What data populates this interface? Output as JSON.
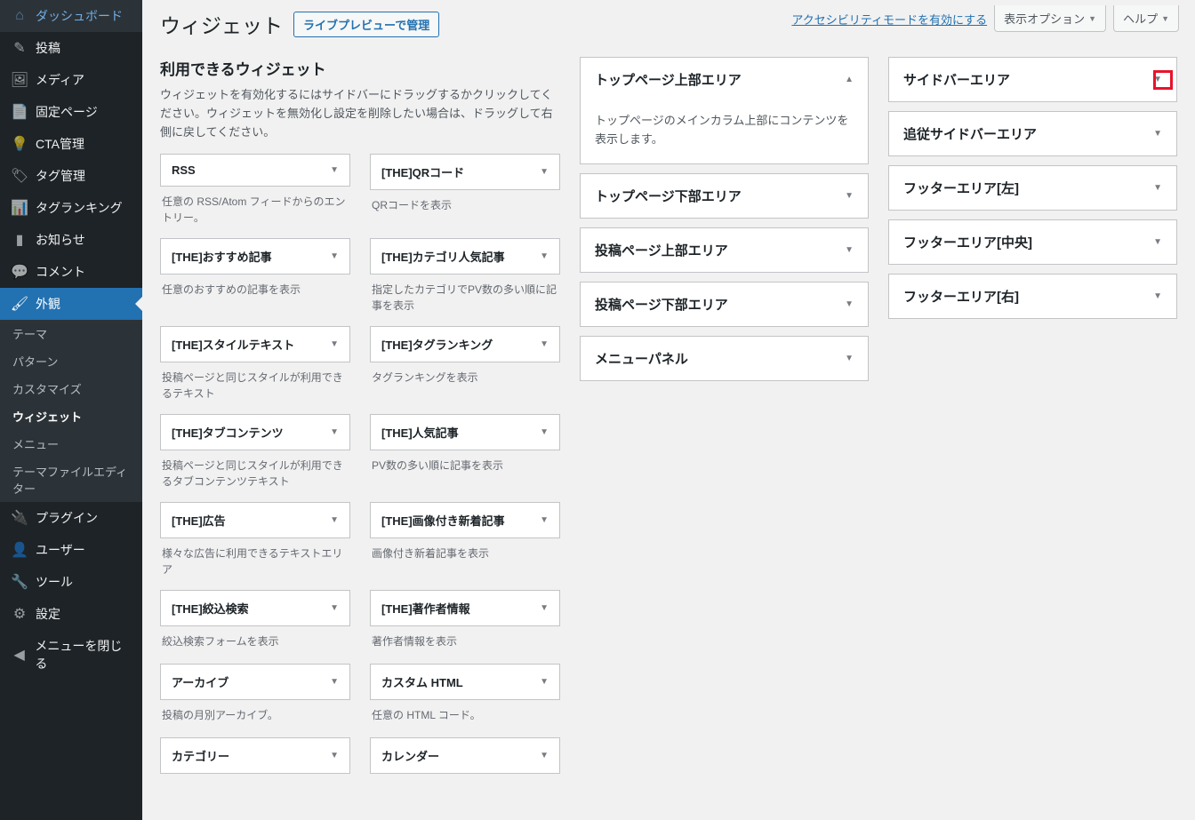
{
  "sidebar": {
    "items": [
      {
        "icon": "dashboard",
        "label": "ダッシュボード"
      },
      {
        "icon": "pin",
        "label": "投稿"
      },
      {
        "icon": "media",
        "label": "メディア"
      },
      {
        "icon": "page",
        "label": "固定ページ"
      },
      {
        "icon": "bulb",
        "label": "CTA管理"
      },
      {
        "icon": "tag",
        "label": "タグ管理"
      },
      {
        "icon": "rank",
        "label": "タグランキング"
      },
      {
        "icon": "news",
        "label": "お知らせ"
      },
      {
        "icon": "comment",
        "label": "コメント"
      },
      {
        "icon": "appearance",
        "label": "外観",
        "current": true
      },
      {
        "icon": "plugin",
        "label": "プラグイン"
      },
      {
        "icon": "user",
        "label": "ユーザー"
      },
      {
        "icon": "tool",
        "label": "ツール"
      },
      {
        "icon": "settings",
        "label": "設定"
      },
      {
        "icon": "collapse",
        "label": "メニューを閉じる"
      }
    ],
    "sub": [
      {
        "label": "テーマ"
      },
      {
        "label": "パターン"
      },
      {
        "label": "カスタマイズ"
      },
      {
        "label": "ウィジェット",
        "current": true
      },
      {
        "label": "メニュー"
      },
      {
        "label": "テーマファイルエディター"
      }
    ]
  },
  "topbar": {
    "accessibility": "アクセシビリティモードを有効にする",
    "screen_options": "表示オプション",
    "help": "ヘルプ"
  },
  "page": {
    "title": "ウィジェット",
    "preview_btn": "ライブプレビューで管理"
  },
  "available": {
    "heading": "利用できるウィジェット",
    "desc": "ウィジェットを有効化するにはサイドバーにドラッグするかクリックしてください。ウィジェットを無効化し設定を削除したい場合は、ドラッグして右側に戻してください。"
  },
  "widgets": [
    {
      "name": "RSS",
      "desc": "任意の RSS/Atom フィードからのエントリー。"
    },
    {
      "name": "[THE]QRコード",
      "desc": "QRコードを表示"
    },
    {
      "name": "[THE]おすすめ記事",
      "desc": "任意のおすすめの記事を表示"
    },
    {
      "name": "[THE]カテゴリ人気記事",
      "desc": "指定したカテゴリでPV数の多い順に記事を表示"
    },
    {
      "name": "[THE]スタイルテキスト",
      "desc": "投稿ページと同じスタイルが利用できるテキスト"
    },
    {
      "name": "[THE]タグランキング",
      "desc": "タグランキングを表示"
    },
    {
      "name": "[THE]タブコンテンツ",
      "desc": "投稿ページと同じスタイルが利用できるタブコンテンツテキスト"
    },
    {
      "name": "[THE]人気記事",
      "desc": "PV数の多い順に記事を表示"
    },
    {
      "name": "[THE]広告",
      "desc": "様々な広告に利用できるテキストエリア"
    },
    {
      "name": "[THE]画像付き新着記事",
      "desc": "画像付き新着記事を表示"
    },
    {
      "name": "[THE]絞込検索",
      "desc": "絞込検索フォームを表示"
    },
    {
      "name": "[THE]著作者情報",
      "desc": "著作者情報を表示"
    },
    {
      "name": "アーカイブ",
      "desc": "投稿の月別アーカイブ。"
    },
    {
      "name": "カスタム HTML",
      "desc": "任意の HTML コード。"
    },
    {
      "name": "カテゴリー",
      "desc": ""
    },
    {
      "name": "カレンダー",
      "desc": ""
    }
  ],
  "areas_mid": [
    {
      "name": "トップページ上部エリア",
      "expanded": true,
      "content": "トップページのメインカラム上部にコンテンツを表示します。"
    },
    {
      "name": "トップページ下部エリア"
    },
    {
      "name": "投稿ページ上部エリア"
    },
    {
      "name": "投稿ページ下部エリア"
    },
    {
      "name": "メニューパネル"
    }
  ],
  "areas_right": [
    {
      "name": "サイドバーエリア",
      "highlight": true
    },
    {
      "name": "追従サイドバーエリア"
    },
    {
      "name": "フッターエリア[左]"
    },
    {
      "name": "フッターエリア[中央]"
    },
    {
      "name": "フッターエリア[右]"
    }
  ]
}
